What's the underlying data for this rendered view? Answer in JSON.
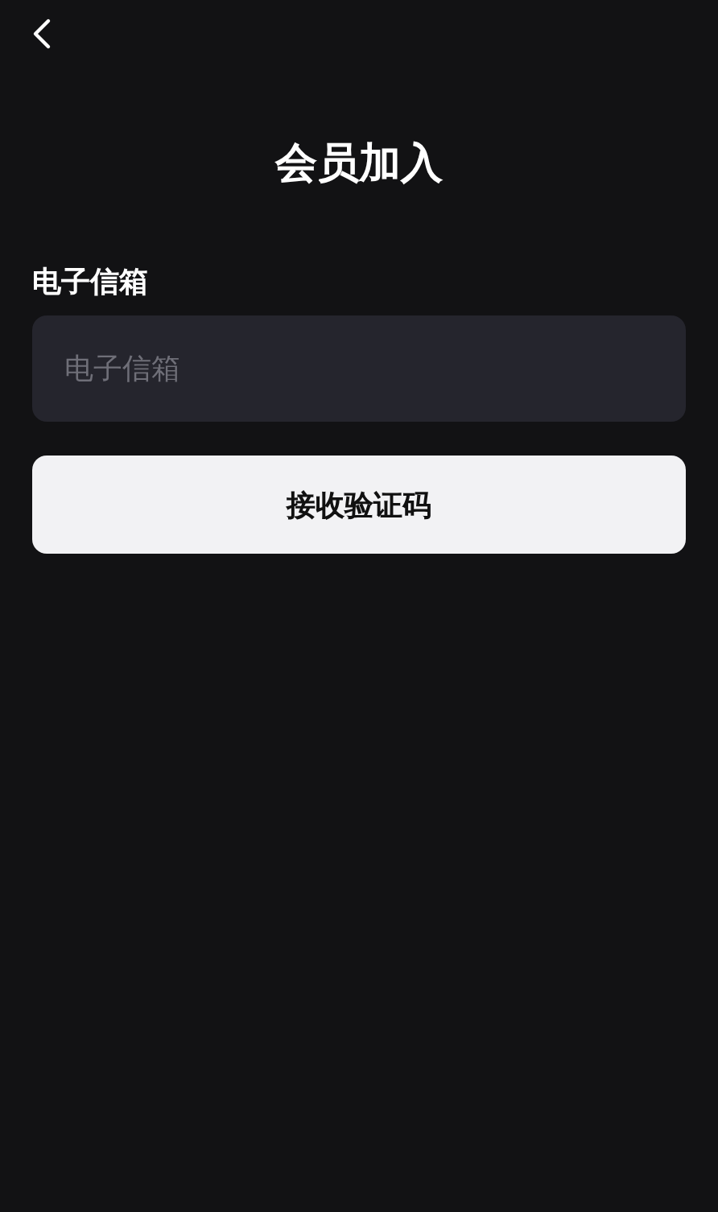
{
  "title": "会员加入",
  "email": {
    "label": "电子信箱",
    "placeholder": "电子信箱"
  },
  "submit_button": "接收验证码"
}
